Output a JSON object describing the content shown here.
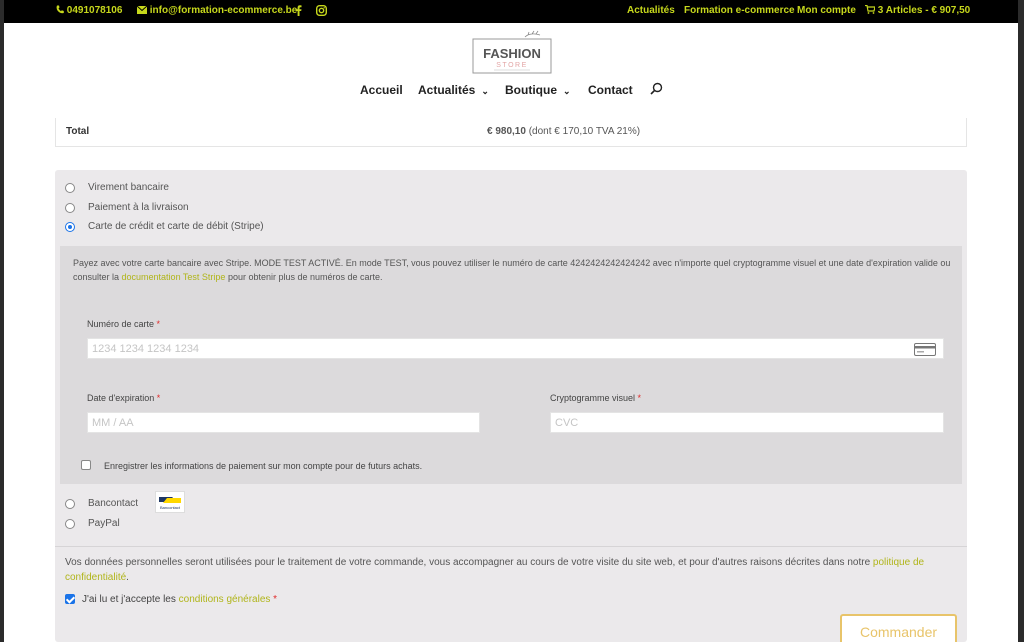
{
  "topbar": {
    "phone": "0491078106",
    "email": "info@formation-ecommerce.be",
    "links": [
      "Actualités",
      "Formation e-commerce",
      "Mon compte"
    ],
    "cart": "3 Articles - € 907,50"
  },
  "logo": {
    "line1": "FASHION",
    "line2": "STORE"
  },
  "nav": {
    "items": [
      "Accueil",
      "Actualités",
      "Boutique",
      "Contact"
    ]
  },
  "order_total": {
    "label": "Total",
    "amount": "€ 980,10",
    "tax_note": "(dont € 170,10 TVA 21%)"
  },
  "payment": {
    "methods": [
      {
        "label": "Virement bancaire",
        "selected": false
      },
      {
        "label": "Paiement à la livraison",
        "selected": false
      },
      {
        "label": "Carte de crédit et carte de débit (Stripe)",
        "selected": true
      },
      {
        "label": "Bancontact",
        "selected": false
      },
      {
        "label": "PayPal",
        "selected": false
      }
    ],
    "stripe": {
      "desc_part1": "Payez avec votre carte bancaire avec Stripe. MODE TEST ACTIVÉ. En mode TEST, vous pouvez utiliser le numéro de carte 4242424242424242 avec n'importe quel cryptogramme visuel et une date d'expiration valide ou consulter la ",
      "desc_link": "documentation Test Stripe",
      "desc_part2": " pour obtenir plus de numéros de carte.",
      "card_number_label": "Numéro de carte",
      "card_number_placeholder": "1234 1234 1234 1234",
      "expiry_label": "Date d'expiration",
      "expiry_placeholder": "MM / AA",
      "cvc_label": "Cryptogramme visuel",
      "cvc_placeholder": "CVC",
      "required_mark": "*",
      "save_label": "Enregistrer les informations de paiement sur mon compte pour de futurs achats."
    },
    "bancontact_logo_text": "Bancontact"
  },
  "privacy": {
    "text": "Vos données personnelles seront utilisées pour le traitement de votre commande, vous accompagner au cours de votre visite du site web, et pour d'autres raisons décrites dans notre ",
    "link": "politique de confidentialité",
    "end": "."
  },
  "terms": {
    "text": "J'ai lu et j'accepte les ",
    "link": "conditions générales",
    "required_mark": "*"
  },
  "order_button": "Commander",
  "colors": {
    "accent": "#c7d81c",
    "link": "#b0b51a",
    "button": "#e8c46a"
  }
}
